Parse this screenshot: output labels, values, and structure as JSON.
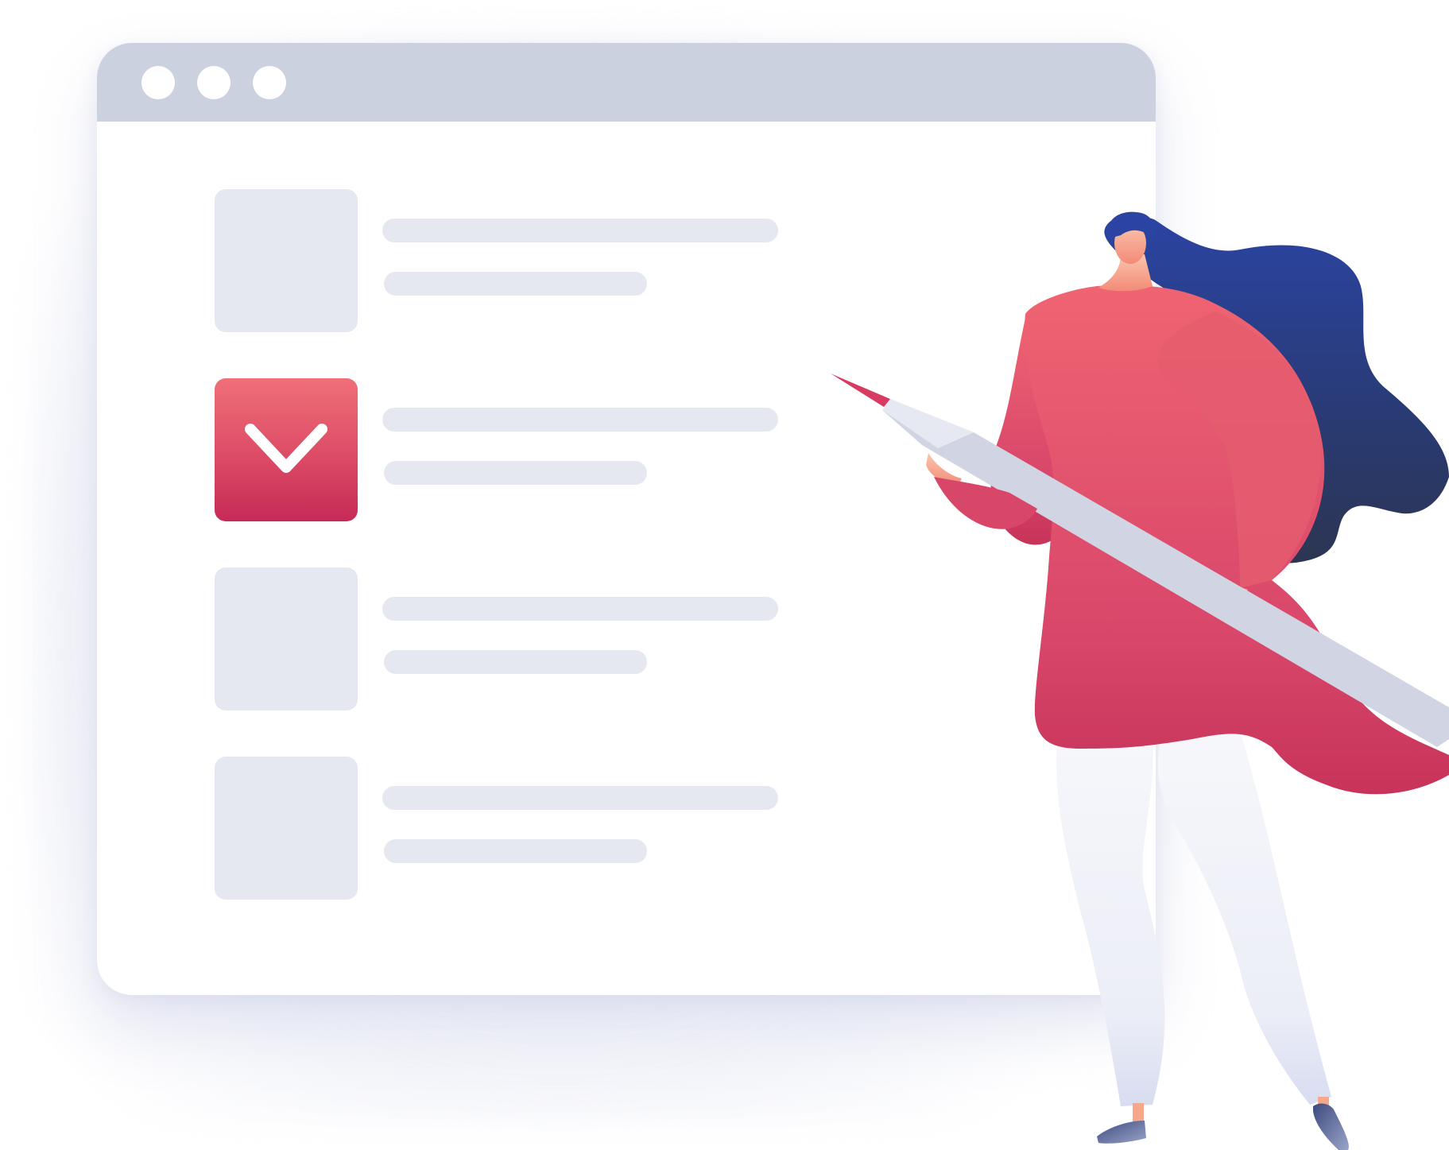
{
  "illustration": {
    "subject": "checklist-browser-window-with-woman-holding-pencil",
    "colors": {
      "window_frame": "#ccd1e0",
      "placeholder": "#e6e8f1",
      "check_accent_top": "#f06f79",
      "check_accent_bottom": "#c62a56",
      "hair": "#2a3f8f",
      "skin": "#f7a88a",
      "pants": "#eceef7",
      "pencil": "#d1d5e3"
    }
  },
  "browser": {
    "title_bar_dots": 3,
    "checklist": [
      {
        "checked": false
      },
      {
        "checked": true
      },
      {
        "checked": false
      },
      {
        "checked": false
      }
    ]
  }
}
